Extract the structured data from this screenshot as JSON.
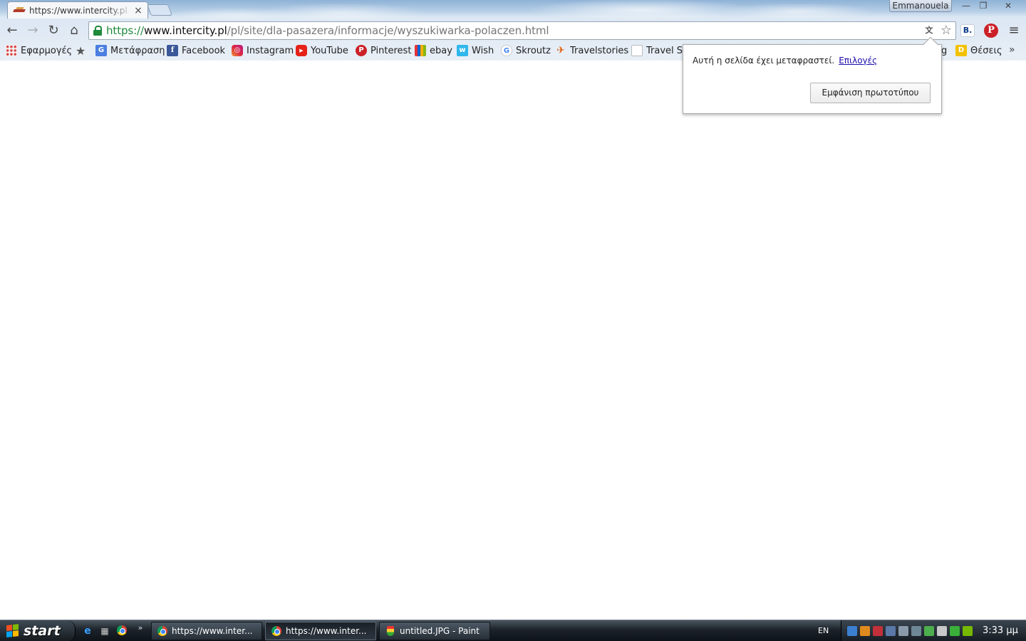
{
  "window": {
    "profile_name": "Emmanouela",
    "minimize": "—",
    "maximize": "❐",
    "close": "✕"
  },
  "tabs": [
    {
      "title": "https://www.intercity.pl",
      "close": "×"
    }
  ],
  "toolbar": {
    "back": "←",
    "forward": "→",
    "reload": "↻",
    "home": "⌂",
    "url_scheme": "https://",
    "url_host": "www.intercity.pl",
    "url_path": "/pl/site/dla-pasazera/informacje/wyszukiwarka-polaczen.html",
    "translate_icon": "文A",
    "star": "☆",
    "ext_b": "B.",
    "ext_pinterest": "P",
    "menu": "≡"
  },
  "bookmarks": {
    "items": [
      {
        "label": "Εφαρμογές",
        "icon": "apps-icon"
      },
      {
        "label": "",
        "icon": "star-icon",
        "glyph": "★"
      },
      {
        "label": "Μετάφραση",
        "icon": "translate-icon",
        "glyph": "G"
      },
      {
        "label": "Facebook",
        "icon": "facebook-icon",
        "glyph": "f"
      },
      {
        "label": "Instagram",
        "icon": "instagram-icon",
        "glyph": "◎"
      },
      {
        "label": "YouTube",
        "icon": "youtube-icon",
        "glyph": "▶"
      },
      {
        "label": "Pinterest",
        "icon": "pinterest-icon",
        "glyph": "P"
      },
      {
        "label": "ebay",
        "icon": "ebay-icon",
        "glyph": ""
      },
      {
        "label": "Wish",
        "icon": "wish-icon",
        "glyph": "w"
      },
      {
        "label": "Skroutz",
        "icon": "google-icon",
        "glyph": "G"
      },
      {
        "label": "Travelstories",
        "icon": "plane-icon",
        "glyph": "✈"
      },
      {
        "label": "Travel St",
        "icon": "blank-page-icon",
        "glyph": ""
      },
      {
        "label": "g",
        "icon": "",
        "glyph": ""
      },
      {
        "label": "Θέσεις",
        "icon": "d-icon",
        "glyph": "D"
      }
    ],
    "more": "»"
  },
  "translate_popup": {
    "message": "Αυτή η σελίδα έχει μεταφραστεί.",
    "options_link": "Επιλογές",
    "show_original_button": "Εμφάνιση πρωτοτύπου"
  },
  "taskbar": {
    "start_label": "start",
    "quick_launch_more": "»",
    "tasks": [
      {
        "label": "https://www.inter...",
        "app": "chrome"
      },
      {
        "label": "https://www.inter...",
        "app": "chrome"
      },
      {
        "label": "untitled.JPG - Paint",
        "app": "paint"
      }
    ],
    "language": "EN",
    "clock": "3:33 μμ"
  }
}
